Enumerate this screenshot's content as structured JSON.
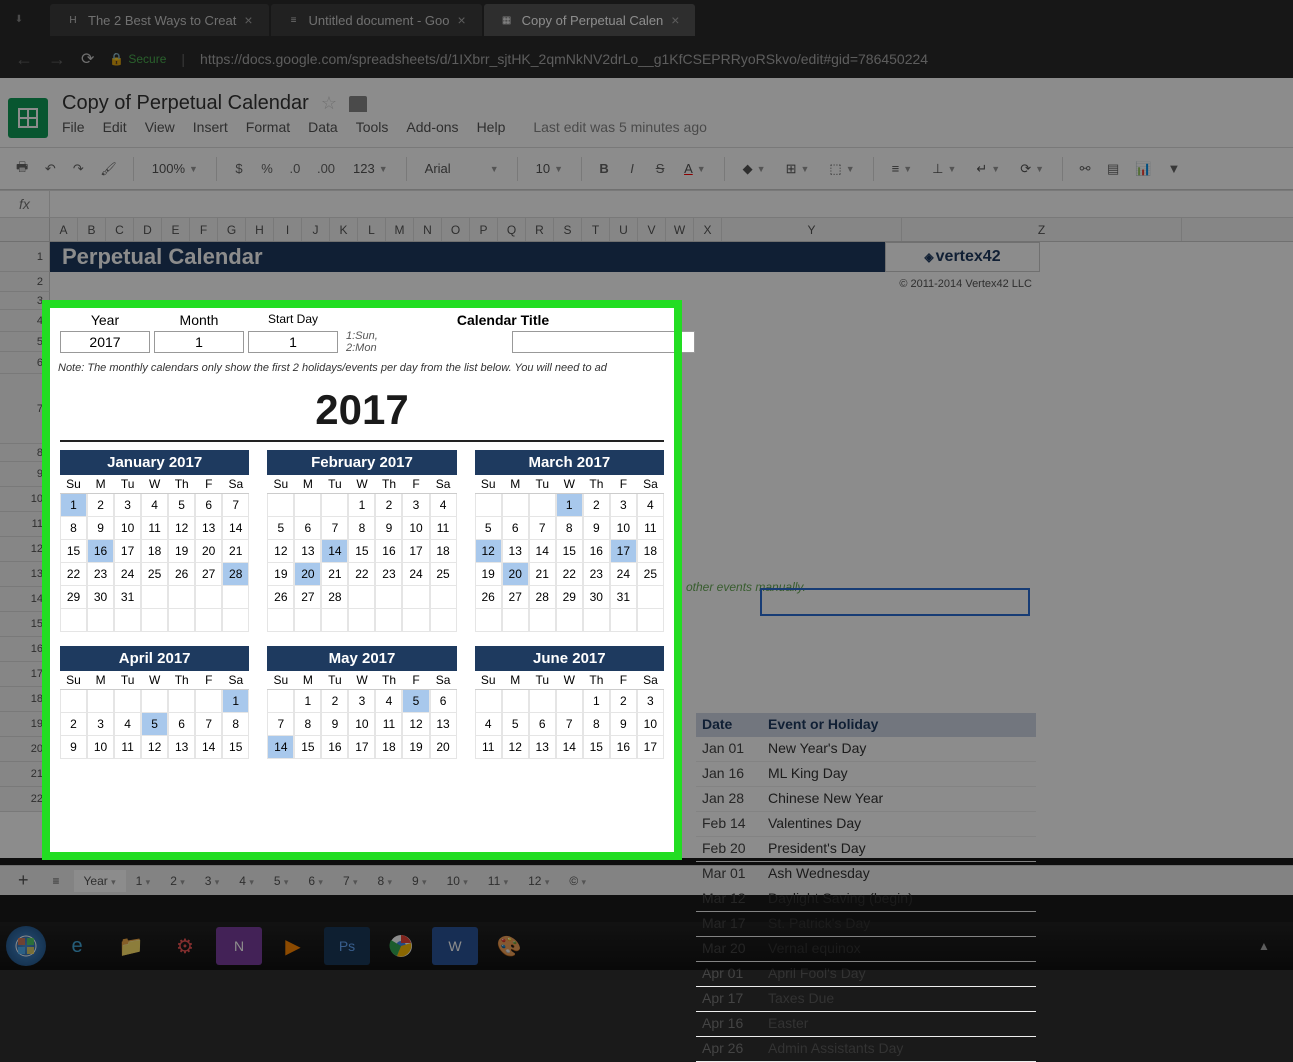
{
  "browser": {
    "tabs": [
      {
        "favicon": "H",
        "label": "The 2 Best Ways to Creat"
      },
      {
        "favicon": "≡",
        "label": "Untitled document - Goo"
      },
      {
        "favicon": "▦",
        "label": "Copy of Perpetual Calen"
      }
    ],
    "secure_label": "Secure",
    "url": "https://docs.google.com/spreadsheets/d/1IXbrr_sjtHK_2qmNkNV2drLo__g1KfCSEPRRyoRSkvo/edit#gid=786450224"
  },
  "sheets": {
    "doc_title": "Copy of Perpetual Calendar",
    "menus": [
      "File",
      "Edit",
      "View",
      "Insert",
      "Format",
      "Data",
      "Tools",
      "Add-ons",
      "Help"
    ],
    "last_edit": "Last edit was 5 minutes ago",
    "zoom": "100%",
    "font": "Arial",
    "font_size": "10",
    "fx_label": "fx",
    "columns": [
      "A",
      "B",
      "C",
      "D",
      "E",
      "F",
      "G",
      "H",
      "I",
      "J",
      "K",
      "L",
      "M",
      "N",
      "O",
      "P",
      "Q",
      "R",
      "S",
      "T",
      "U",
      "V",
      "W",
      "X",
      "Y",
      "Z"
    ],
    "rows": [
      "1",
      "2",
      "3",
      "4",
      "5",
      "6",
      "7",
      "8",
      "9",
      "10",
      "11",
      "12",
      "13",
      "14",
      "15",
      "16",
      "17",
      "18",
      "19",
      "20",
      "21",
      "22"
    ]
  },
  "calendar": {
    "banner_title": "Perpetual Calendar",
    "vertex_logo": "vertex42",
    "copyright": "© 2011-2014 Vertex42 LLC",
    "labels": {
      "year": "Year",
      "month": "Month",
      "start_day": "Start Day",
      "title": "Calendar Title",
      "hint": "1:Sun, 2:Mon"
    },
    "inputs": {
      "year": "2017",
      "month": "1",
      "start_day": "1",
      "title": ""
    },
    "note": "Note: The monthly calendars only show the first 2 holidays/events per day from the list below. You will need to ad",
    "note_ext": "other events manually.",
    "year_display": "2017",
    "day_headers": [
      "Su",
      "M",
      "Tu",
      "W",
      "Th",
      "F",
      "Sa"
    ],
    "months": [
      {
        "name": "January 2017",
        "start": 0,
        "days": 31,
        "hl": [
          1,
          16,
          28
        ]
      },
      {
        "name": "February 2017",
        "start": 3,
        "days": 28,
        "hl": [
          14,
          20
        ]
      },
      {
        "name": "March 2017",
        "start": 3,
        "days": 31,
        "hl": [
          1,
          12,
          17,
          20
        ]
      },
      {
        "name": "April 2017",
        "start": 6,
        "days": 30,
        "hl": [
          1,
          5
        ]
      },
      {
        "name": "May 2017",
        "start": 1,
        "days": 31,
        "hl": [
          5,
          14
        ]
      },
      {
        "name": "June 2017",
        "start": 4,
        "days": 30,
        "hl": []
      }
    ],
    "month_rows_visible": 4
  },
  "events": {
    "header_date": "Date",
    "header_event": "Event or Holiday",
    "items": [
      {
        "date": "Jan 01",
        "name": "New Year's Day"
      },
      {
        "date": "Jan 16",
        "name": "ML King Day"
      },
      {
        "date": "Jan 28",
        "name": "Chinese New Year"
      },
      {
        "date": "Feb 14",
        "name": "Valentines Day"
      },
      {
        "date": "Feb 20",
        "name": "President's Day"
      },
      {
        "date": "Mar 01",
        "name": "Ash Wednesday"
      },
      {
        "date": "Mar 12",
        "name": "Daylight Saving (begin)"
      },
      {
        "date": "Mar 17",
        "name": "St. Patrick's Day"
      },
      {
        "date": "Mar 20",
        "name": "Vernal equinox"
      },
      {
        "date": "Apr 01",
        "name": "April Fool's Day"
      },
      {
        "date": "Apr 17",
        "name": "Taxes Due"
      },
      {
        "date": "Apr 16",
        "name": "Easter"
      },
      {
        "date": "Apr 26",
        "name": "Admin Assistants Day"
      }
    ]
  },
  "sheet_tabs": [
    "Year",
    "1",
    "2",
    "3",
    "4",
    "5",
    "6",
    "7",
    "8",
    "9",
    "10",
    "11",
    "12",
    "©"
  ]
}
